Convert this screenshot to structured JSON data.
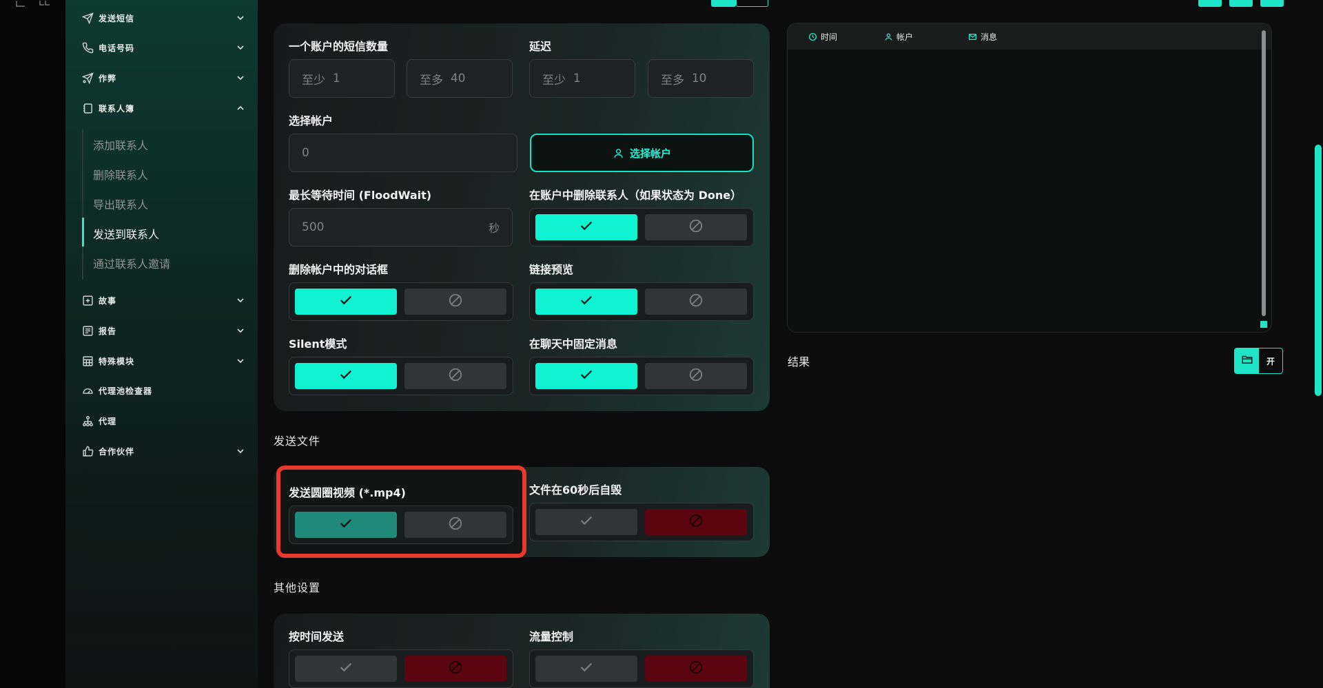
{
  "sidebar": {
    "items": [
      {
        "label": "发送短信",
        "icon": "paper-plane-icon",
        "expanded": false
      },
      {
        "label": "电话号码",
        "icon": "phone-icon",
        "expanded": false
      },
      {
        "label": "作弊",
        "icon": "send-cheat-icon",
        "expanded": false
      },
      {
        "label": "联系人簿",
        "icon": "contact-book-icon",
        "expanded": true
      },
      {
        "label": "故事",
        "icon": "plus-square-icon",
        "expanded": false
      },
      {
        "label": "报告",
        "icon": "report-icon",
        "expanded": false
      },
      {
        "label": "特殊模块",
        "icon": "table-icon",
        "expanded": false
      },
      {
        "label": "代理池检查器",
        "icon": "gauge-icon",
        "expanded": null
      },
      {
        "label": "代理",
        "icon": "network-icon",
        "expanded": null
      },
      {
        "label": "合作伙伴",
        "icon": "thumbs-up-icon",
        "expanded": false
      }
    ],
    "sub_items": [
      "添加联系人",
      "删除联系人",
      "导出联系人",
      "发送到联系人",
      "通过联系人邀请"
    ],
    "active_sub": "发送到联系人"
  },
  "form": {
    "sms_count_label": "一个账户的短信数量",
    "sms_min_placeholder": "至少",
    "sms_min_value": "1",
    "sms_max_placeholder": "至多",
    "sms_max_value": "40",
    "delay_label": "延迟",
    "delay_min_placeholder": "至少",
    "delay_min_value": "1",
    "delay_max_placeholder": "至多",
    "delay_max_value": "10",
    "select_account_label": "选择帐户",
    "select_account_value": "0",
    "select_account_button": "选择帐户",
    "floodwait_label": "最长等待时间 (FloodWait)",
    "floodwait_value": "500",
    "floodwait_unit": "秒",
    "delete_contacts_label": "在账户中删除联系人（如果状态为 Done）",
    "delete_dialog_label": "删除帐户中的对话框",
    "link_preview_label": "链接预览",
    "silent_label": "Silent模式",
    "pin_message_label": "在聊天中固定消息"
  },
  "files_section": {
    "title": "发送文件",
    "round_video_label": "发送圆圈视频 (*.mp4)",
    "self_destruct_label": "文件在60秒后自毁"
  },
  "other_section": {
    "title": "其他设置",
    "schedule_label": "按时间发送",
    "flow_control_label": "流量控制"
  },
  "log": {
    "col_time": "时间",
    "col_account": "帐户",
    "col_message": "消息"
  },
  "results": {
    "label": "结果",
    "open_label": "开"
  },
  "colors": {
    "accent": "#10f3d3",
    "danger": "#5a0510",
    "highlight": "#e8392e"
  }
}
